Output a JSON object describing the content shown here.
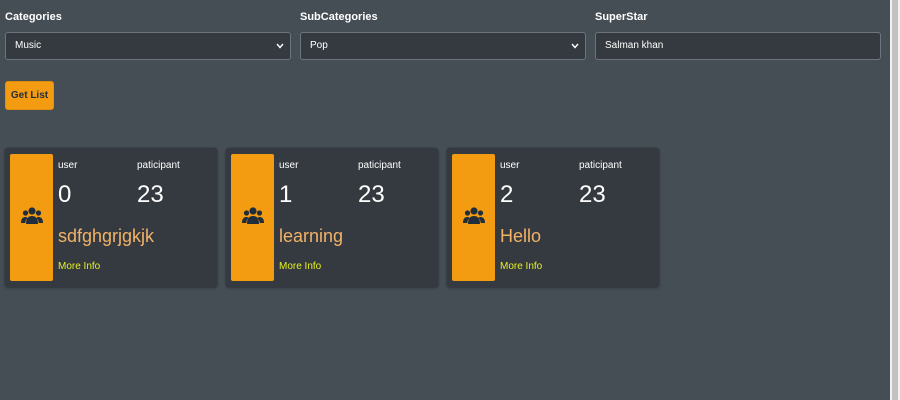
{
  "filters": {
    "categories": {
      "label": "Categories",
      "value": "Music"
    },
    "subcategories": {
      "label": "SubCategories",
      "value": "Pop"
    },
    "superstar": {
      "label": "SuperStar",
      "value": "Salman khan"
    }
  },
  "actions": {
    "get_list_label": "Get List"
  },
  "cards": [
    {
      "user_label": "user",
      "participant_label": "paticipant",
      "user_value": "0",
      "participant_value": "23",
      "name": "sdfghgrjgkjk",
      "more_info": "More Info",
      "icon": "users-icon"
    },
    {
      "user_label": "user",
      "participant_label": "paticipant",
      "user_value": "1",
      "participant_value": "23",
      "name": "learning",
      "more_info": "More Info",
      "icon": "users-icon"
    },
    {
      "user_label": "user",
      "participant_label": "paticipant",
      "user_value": "2",
      "participant_value": "23",
      "name": "Hello",
      "more_info": "More Info",
      "icon": "users-icon"
    }
  ],
  "colors": {
    "background": "#454d55",
    "card": "#343a40",
    "accent": "#f39c12",
    "name_text": "#f3b266",
    "link_text": "#e6f020"
  }
}
